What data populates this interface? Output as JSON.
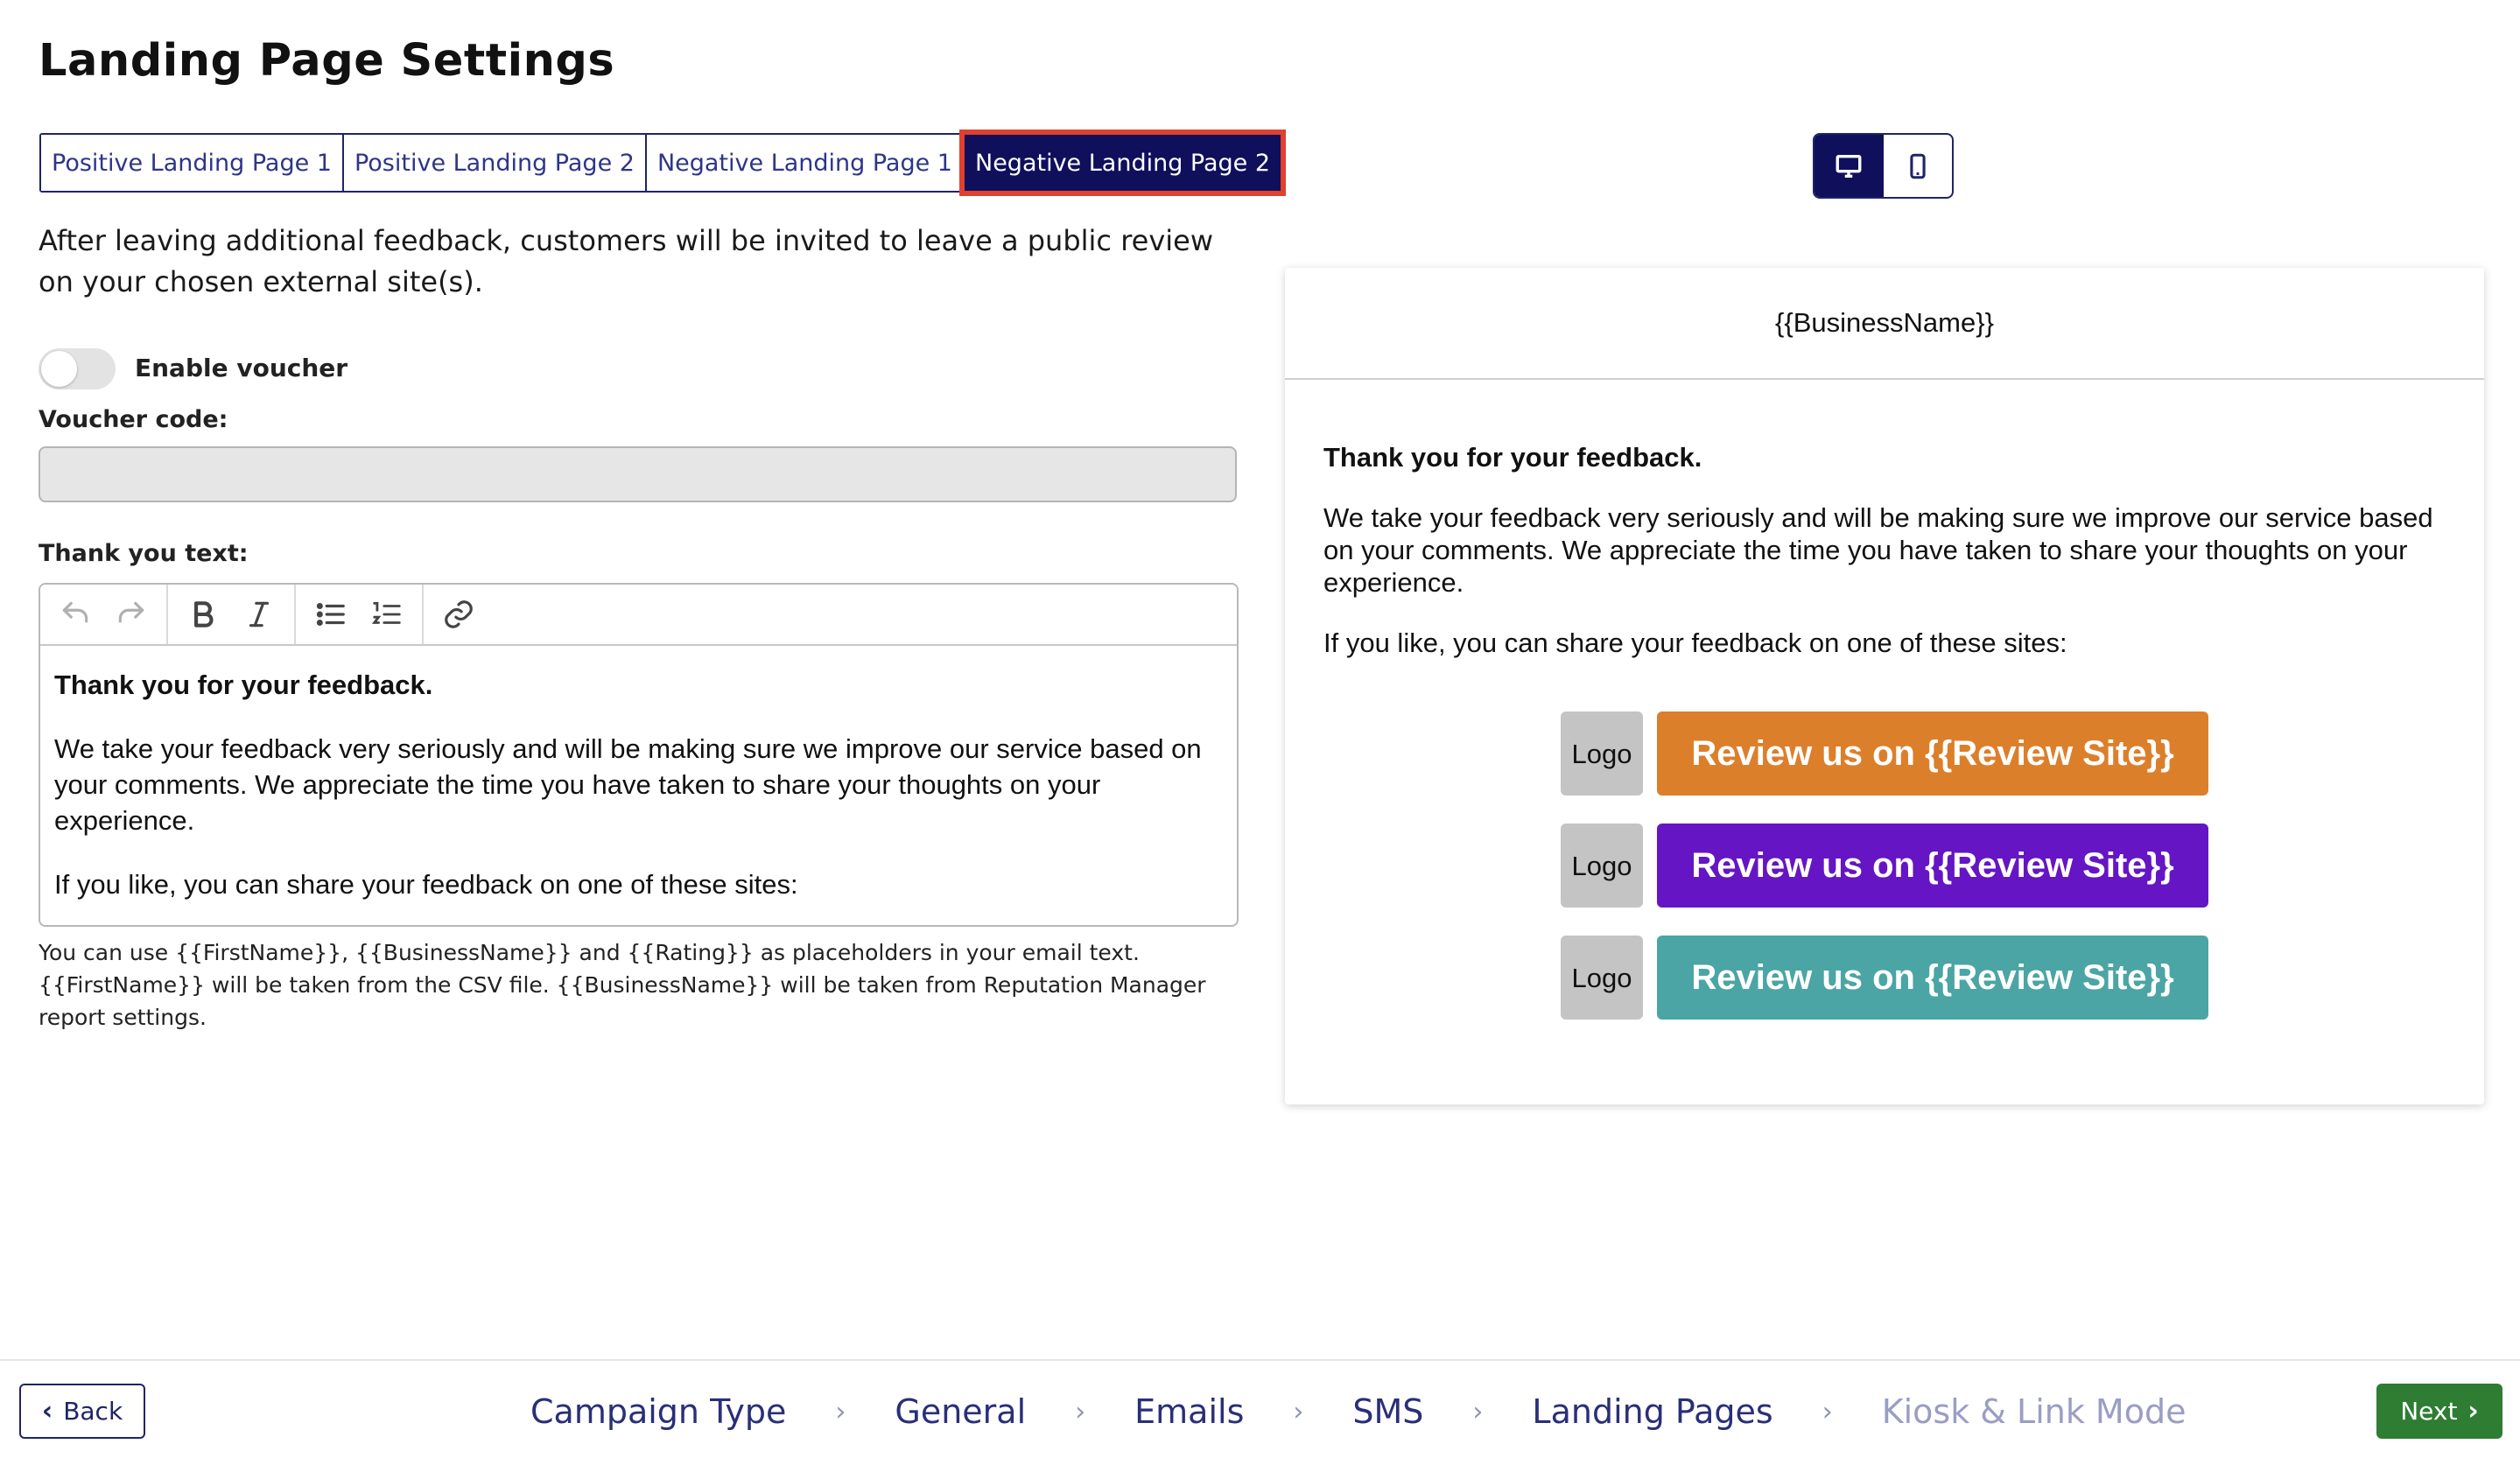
{
  "page": {
    "title": "Landing Page Settings"
  },
  "tabs": [
    {
      "label": "Positive Landing Page 1",
      "active": false
    },
    {
      "label": "Positive Landing Page 2",
      "active": false
    },
    {
      "label": "Negative Landing Page 1",
      "active": false
    },
    {
      "label": "Negative Landing Page 2",
      "active": true
    }
  ],
  "form": {
    "intro": "After leaving additional feedback, customers will be invited to leave a public review on your chosen external site(s).",
    "voucher_toggle_label": "Enable voucher",
    "voucher_toggle_on": false,
    "voucher_code_label": "Voucher code:",
    "voucher_code_value": "",
    "thank_you_label": "Thank you text:",
    "editor": {
      "toolbar_icons": [
        "undo-icon",
        "redo-icon",
        "bold-icon",
        "italic-icon",
        "bullet-list-icon",
        "numbered-list-icon",
        "link-icon"
      ],
      "heading": "Thank you for your feedback.",
      "paragraph1": "We take your feedback very seriously and will be making sure we improve our service based on your comments. We appreciate the time you have taken to share your thoughts on your experience.",
      "paragraph2": "If you like, you can share your feedback on one of these sites:"
    },
    "helper_text": "You can use {{FirstName}}, {{BusinessName}} and {{Rating}} as placeholders in your email text. {{FirstName}} will be taken from the CSV file. {{BusinessName}} will be taken from Reputation Manager report settings."
  },
  "view_toggle": {
    "icons": [
      "desktop-icon",
      "mobile-icon"
    ],
    "active": "desktop"
  },
  "preview": {
    "header": "{{BusinessName}}",
    "heading": "Thank you for your feedback.",
    "paragraph1": "We take your feedback very seriously and will be making sure we improve our service based on your comments. We appreciate the time you have taken to share your thoughts on your experience.",
    "paragraph2": "If you like, you can share your feedback on one of these sites:",
    "review_buttons": [
      {
        "logo": "Logo",
        "label": "Review us on {{Review Site}}",
        "color": "#dc7f2b"
      },
      {
        "logo": "Logo",
        "label": "Review us on {{Review Site}}",
        "color": "#6515c4"
      },
      {
        "logo": "Logo",
        "label": "Review us on {{Review Site}}",
        "color": "#4ba5a4"
      }
    ]
  },
  "footer": {
    "back_label": "Back",
    "next_label": "Next",
    "steps": [
      {
        "label": "Campaign Type",
        "enabled": true
      },
      {
        "label": "General",
        "enabled": true
      },
      {
        "label": "Emails",
        "enabled": true
      },
      {
        "label": "SMS",
        "enabled": true
      },
      {
        "label": "Landing Pages",
        "enabled": true
      },
      {
        "label": "Kiosk & Link Mode",
        "enabled": false
      }
    ]
  },
  "colors": {
    "navy": "#0f0f5c",
    "highlight": "#e0402e",
    "next_green": "#2e7d32"
  }
}
